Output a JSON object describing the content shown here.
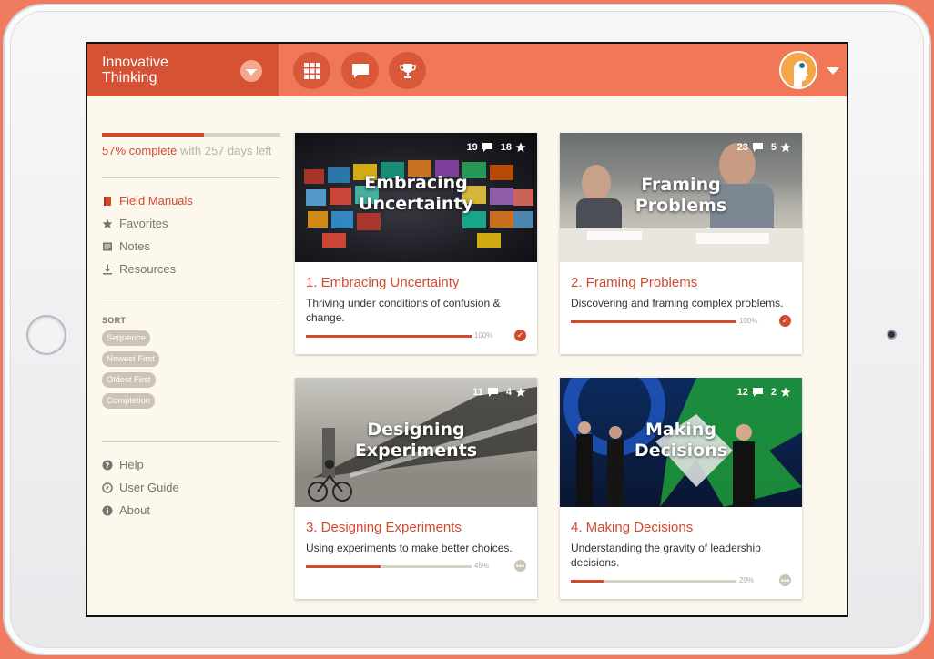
{
  "app": {
    "title": "Innovative\nThinking"
  },
  "nav": {
    "buttons": [
      {
        "icon": "grid-icon"
      },
      {
        "icon": "chat-bubble-icon"
      },
      {
        "icon": "trophy-icon"
      }
    ]
  },
  "sidebar": {
    "progress": {
      "percent": 57,
      "percent_text": "57% complete",
      "remaining_text": " with 257 days left"
    },
    "menu": [
      {
        "label": "Field Manuals",
        "icon": "book-icon",
        "active": true
      },
      {
        "label": "Favorites",
        "icon": "star-icon"
      },
      {
        "label": "Notes",
        "icon": "notes-icon"
      },
      {
        "label": "Resources",
        "icon": "download-icon"
      }
    ],
    "sort": {
      "label": "SORT",
      "options": [
        "Sequence",
        "Newest First",
        "Oldest First",
        "Completion"
      ]
    },
    "help": [
      {
        "label": "Help",
        "icon": "question-icon"
      },
      {
        "label": "User Guide",
        "icon": "compass-icon"
      },
      {
        "label": "About",
        "icon": "info-icon"
      }
    ]
  },
  "cards": [
    {
      "image_title": "Embracing\nUncertainty",
      "comments": "19",
      "stars": "18",
      "title": "1. Embracing Uncertainty",
      "description": "Thriving under conditions of confusion & change.",
      "progress": 100,
      "progress_text": "100%",
      "status": "complete"
    },
    {
      "image_title": "Framing\nProblems",
      "comments": "23",
      "stars": "5",
      "title": "2. Framing Problems",
      "description": "Discovering and framing complex problems.",
      "progress": 100,
      "progress_text": "100%",
      "status": "complete"
    },
    {
      "image_title": "Designing\nExperiments",
      "comments": "11",
      "stars": "4",
      "title": "3. Designing Experiments",
      "description": "Using experiments to make better choices.",
      "progress": 45,
      "progress_text": "45%",
      "status": "in-progress"
    },
    {
      "image_title": "Making\nDecisions",
      "comments": "12",
      "stars": "2",
      "title": "4. Making Decisions",
      "description": "Understanding the gravity of leadership decisions.",
      "progress": 20,
      "progress_text": "20%",
      "status": "in-progress"
    }
  ],
  "colors": {
    "accent": "#d24a2e",
    "topbar": "#f07858",
    "brand_bg": "#d55234",
    "background": "#fcf8ee"
  }
}
